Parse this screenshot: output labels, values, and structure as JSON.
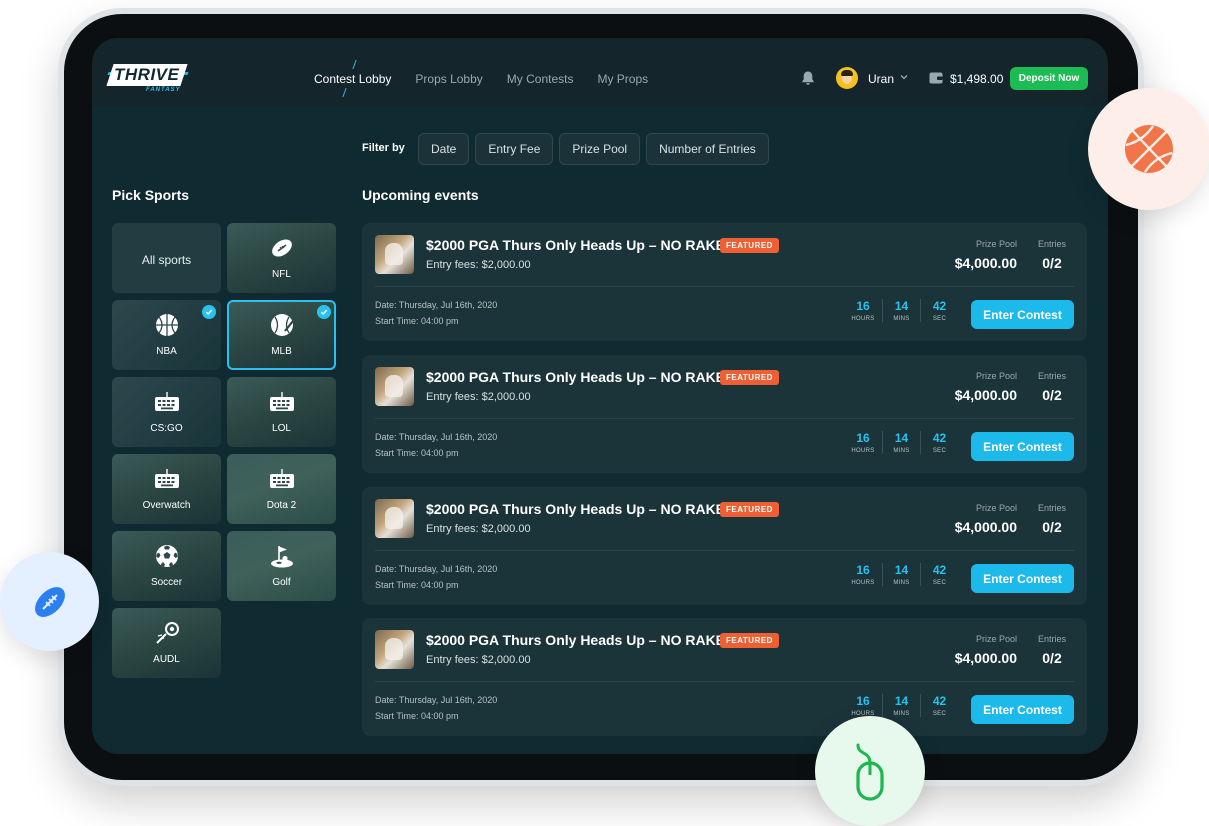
{
  "brand": {
    "logo_text": "THRIVE",
    "logo_sub": "FANTASY"
  },
  "nav": {
    "items": [
      {
        "label": "Contest Lobby",
        "active": true
      },
      {
        "label": "Props Lobby",
        "active": false
      },
      {
        "label": "My Contests",
        "active": false
      },
      {
        "label": "My Props",
        "active": false
      }
    ]
  },
  "user": {
    "name": "Uran",
    "balance": "$1,498.00",
    "deposit_label": "Deposit Now"
  },
  "filter": {
    "label": "Filter by",
    "options": [
      "Date",
      "Entry Fee",
      "Prize Pool",
      "Number of Entries"
    ]
  },
  "sports": {
    "title": "Pick Sports",
    "tiles": [
      {
        "label": "All sports",
        "icon": "all-sports",
        "selected": false
      },
      {
        "label": "NFL",
        "icon": "football-icon",
        "selected": false
      },
      {
        "label": "NBA",
        "icon": "basketball-icon",
        "selected": true
      },
      {
        "label": "MLB",
        "icon": "baseball-icon",
        "selected": true
      },
      {
        "label": "CS:GO",
        "icon": "keyboard-icon",
        "selected": false
      },
      {
        "label": "LOL",
        "icon": "keyboard-icon",
        "selected": false
      },
      {
        "label": "Overwatch",
        "icon": "keyboard-icon",
        "selected": false
      },
      {
        "label": "Dota 2",
        "icon": "keyboard-icon",
        "selected": false
      },
      {
        "label": "Soccer",
        "icon": "soccer-ball-icon",
        "selected": false
      },
      {
        "label": "Golf",
        "icon": "golf-icon",
        "selected": false
      },
      {
        "label": "AUDL",
        "icon": "frisbee-icon",
        "selected": false
      }
    ]
  },
  "events": {
    "title": "Upcoming events",
    "items": [
      {
        "title": "$2000 PGA Thurs Only Heads Up – NO RAKE",
        "badge": "FEATURED",
        "entry_fee": "Entry fees: $2,000.00",
        "prize_pool_label": "Prize Pool",
        "prize_pool": "$4,000.00",
        "entries_label": "Entries",
        "entries": "0/2",
        "date": "Date: Thursday, Jul 16th, 2020",
        "start_time": "Start Time: 04:00 pm",
        "countdown": [
          {
            "value": "16",
            "unit": "HOURS"
          },
          {
            "value": "14",
            "unit": "MINS"
          },
          {
            "value": "42",
            "unit": "SEC"
          }
        ],
        "cta": "Enter Contest"
      },
      {
        "title": "$2000 PGA Thurs Only Heads Up – NO RAKE",
        "badge": "FEATURED",
        "entry_fee": "Entry fees: $2,000.00",
        "prize_pool_label": "Prize Pool",
        "prize_pool": "$4,000.00",
        "entries_label": "Entries",
        "entries": "0/2",
        "date": "Date: Thursday, Jul 16th, 2020",
        "start_time": "Start Time: 04:00 pm",
        "countdown": [
          {
            "value": "16",
            "unit": "HOURS"
          },
          {
            "value": "14",
            "unit": "MINS"
          },
          {
            "value": "42",
            "unit": "SEC"
          }
        ],
        "cta": "Enter Contest"
      },
      {
        "title": "$2000 PGA Thurs Only Heads Up – NO RAKE",
        "badge": "FEATURED",
        "entry_fee": "Entry fees: $2,000.00",
        "prize_pool_label": "Prize Pool",
        "prize_pool": "$4,000.00",
        "entries_label": "Entries",
        "entries": "0/2",
        "date": "Date: Thursday, Jul 16th, 2020",
        "start_time": "Start Time: 04:00 pm",
        "countdown": [
          {
            "value": "16",
            "unit": "HOURS"
          },
          {
            "value": "14",
            "unit": "MINS"
          },
          {
            "value": "42",
            "unit": "SEC"
          }
        ],
        "cta": "Enter Contest"
      },
      {
        "title": "$2000 PGA Thurs Only Heads Up – NO RAKE",
        "badge": "FEATURED",
        "entry_fee": "Entry fees: $2,000.00",
        "prize_pool_label": "Prize Pool",
        "prize_pool": "$4,000.00",
        "entries_label": "Entries",
        "entries": "0/2",
        "date": "Date: Thursday, Jul 16th, 2020",
        "start_time": "Start Time: 04:00 pm",
        "countdown": [
          {
            "value": "16",
            "unit": "HOURS"
          },
          {
            "value": "14",
            "unit": "MINS"
          },
          {
            "value": "42",
            "unit": "SEC"
          }
        ],
        "cta": "Enter Contest"
      }
    ]
  },
  "floating_icons": [
    "basketball-icon",
    "football-icon",
    "mouse-icon"
  ],
  "colors": {
    "accent": "#1cb9eb",
    "deposit": "#1dbb53",
    "featured": "#ee5f34",
    "screen_bg": "#0f2a30"
  }
}
